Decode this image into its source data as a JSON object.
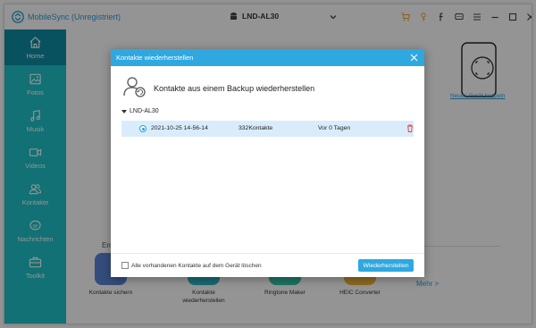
{
  "app": {
    "title": "MobileSync (Unregistriert)"
  },
  "header": {
    "device_name": "LND-AL30",
    "icons": [
      "android-icon",
      "chevron-down-icon",
      "cart-icon",
      "key-icon",
      "facebook-icon",
      "chat-icon",
      "menu-icon",
      "minimize-icon",
      "maximize-icon",
      "close-icon"
    ]
  },
  "sidebar": {
    "items": [
      {
        "label": "Home",
        "icon": "home-icon",
        "active": true
      },
      {
        "label": "Fotos",
        "icon": "photo-icon"
      },
      {
        "label": "Musik",
        "icon": "music-icon"
      },
      {
        "label": "Videos",
        "icon": "video-icon"
      },
      {
        "label": "Kontakte",
        "icon": "contacts-icon"
      },
      {
        "label": "Nachrichten",
        "icon": "message-icon"
      },
      {
        "label": "Toolkit",
        "icon": "toolkit-icon"
      }
    ]
  },
  "main": {
    "new_device_link": "Neues Gerät koppeln",
    "section_label": "En",
    "tools": [
      {
        "label": "Kontakte sichern",
        "color": "#5b86d6"
      },
      {
        "label": "Kontakte wiederherstellen",
        "color": "#2bb6c6"
      },
      {
        "label": "Ringtone Maker",
        "color": "#2fc7a7"
      },
      {
        "label": "HEIC Converter",
        "color": "#f3b63a"
      }
    ],
    "more_link": "Mehr >"
  },
  "dialog": {
    "title": "Kontakte wiederherstellen",
    "heading": "Kontakte aus einem Backup wiederherstellen",
    "device_node": "LND-AL30",
    "backups": [
      {
        "date": "2021-10-25 14-56-14",
        "count": "332Kontakte",
        "age": "Vor 0 Tagen"
      }
    ],
    "delete_checkbox_label": "Alle vorhandenen Kontakte auf dem Gerät löschen",
    "restore_button": "Wiederherstellen"
  },
  "colors": {
    "sidebar": "#1ec3c9",
    "sidebar_active": "#0f8ea6",
    "accent": "#2fa8e0",
    "selected_row": "#d9ecfb"
  }
}
